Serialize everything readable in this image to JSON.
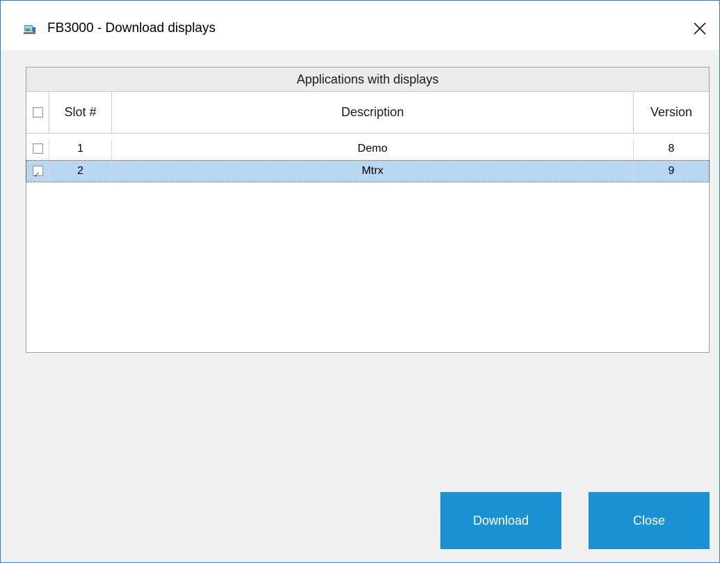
{
  "window": {
    "title": "FB3000 - Download displays",
    "icon": "app-download-icon",
    "close_icon": "close-icon"
  },
  "grid": {
    "group_header": "Applications with displays",
    "columns": {
      "select": "",
      "slot": "Slot #",
      "description": "Description",
      "version": "Version"
    },
    "header_checkbox_checked": false,
    "rows": [
      {
        "checked": false,
        "slot": "1",
        "description": "Demo",
        "version": "8",
        "selected": false
      },
      {
        "checked": true,
        "slot": "2",
        "description": "Mtrx",
        "version": "9",
        "selected": true
      }
    ],
    "selection_color": "#b9d7f1"
  },
  "buttons": {
    "download": "Download",
    "close": "Close",
    "color": "#1a91d3"
  }
}
